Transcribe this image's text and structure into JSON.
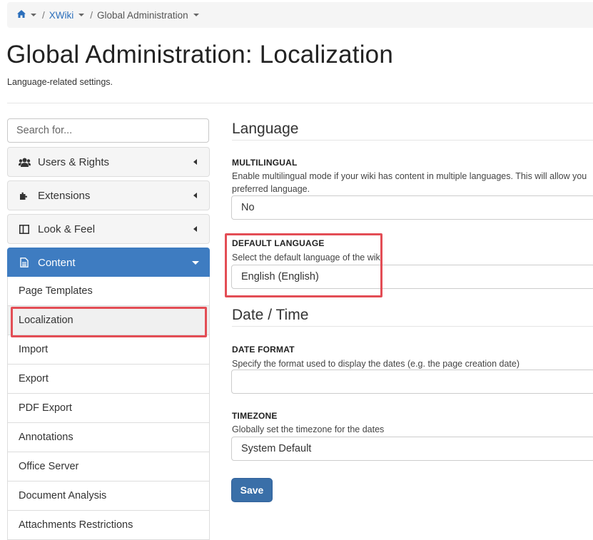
{
  "breadcrumb": {
    "wiki": "XWiki",
    "current": "Global Administration",
    "separator": "/"
  },
  "header": {
    "title": "Global Administration: Localization",
    "subtitle": "Language-related settings."
  },
  "sidebar": {
    "search_placeholder": "Search for...",
    "panels": [
      {
        "label": "Users & Rights",
        "icon": "users-icon"
      },
      {
        "label": "Extensions",
        "icon": "puzzle-icon"
      },
      {
        "label": "Look & Feel",
        "icon": "layout-icon"
      },
      {
        "label": "Content",
        "icon": "document-icon"
      }
    ],
    "content_items": [
      "Page Templates",
      "Localization",
      "Import",
      "Export",
      "PDF Export",
      "Annotations",
      "Office Server",
      "Document Analysis",
      "Attachments Restrictions"
    ]
  },
  "main": {
    "language_section": "Language",
    "multilingual": {
      "label": "MULTILINGUAL",
      "hint_line1": "Enable multilingual mode if your wiki has content in multiple languages. This will allow you",
      "hint_line2": "preferred language.",
      "value": "No"
    },
    "default_language": {
      "label": "DEFAULT LANGUAGE",
      "hint": "Select the default language of the wiki",
      "value": "English (English)"
    },
    "datetime_section": "Date / Time",
    "date_format": {
      "label": "DATE FORMAT",
      "hint": "Specify the format used to display the dates (e.g. the page creation date)",
      "value": ""
    },
    "timezone": {
      "label": "TIMEZONE",
      "hint": "Globally set the timezone for the dates",
      "value": "System Default"
    },
    "save_label": "Save"
  },
  "colors": {
    "accent": "#3e7cc1",
    "link": "#2a6ebb",
    "highlight": "#e34d55",
    "save_button": "#3a6fa8"
  }
}
